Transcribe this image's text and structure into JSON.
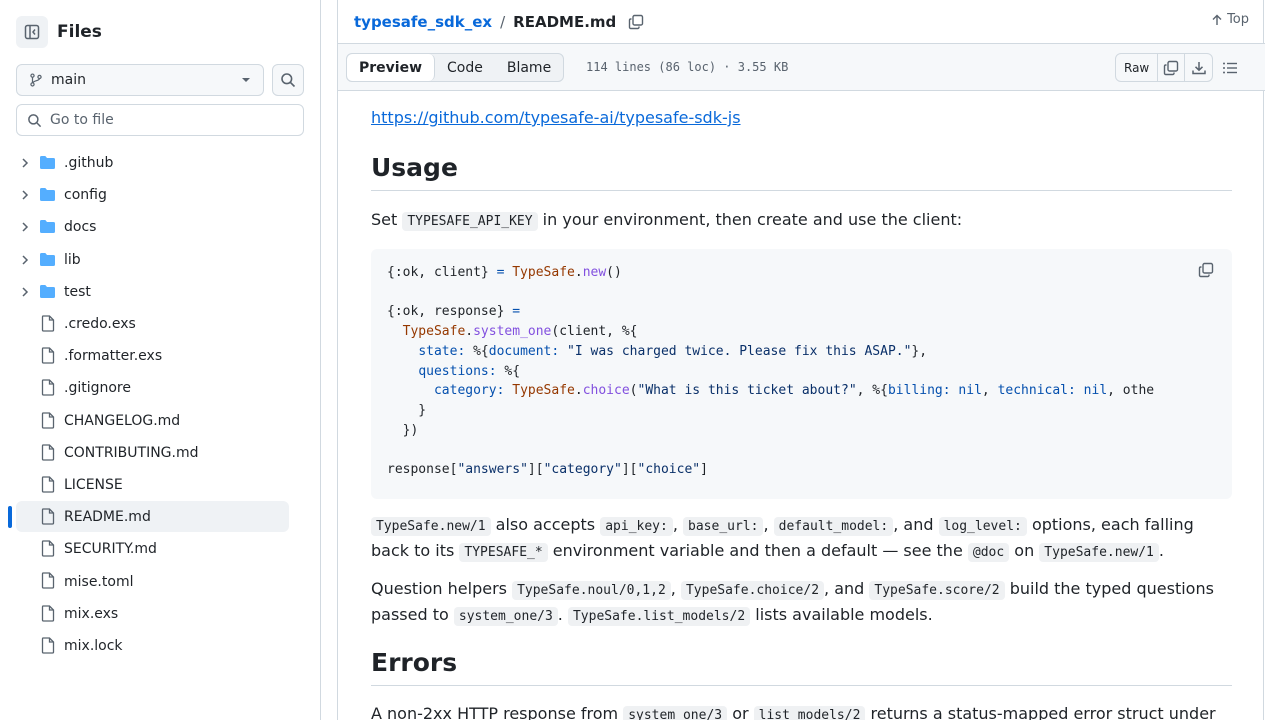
{
  "sidebar": {
    "title": "Files",
    "branch": "main",
    "goto_placeholder": "Go to file",
    "items": [
      {
        "name": ".github",
        "type": "folder"
      },
      {
        "name": "config",
        "type": "folder"
      },
      {
        "name": "docs",
        "type": "folder"
      },
      {
        "name": "lib",
        "type": "folder"
      },
      {
        "name": "test",
        "type": "folder"
      },
      {
        "name": ".credo.exs",
        "type": "file"
      },
      {
        "name": ".formatter.exs",
        "type": "file"
      },
      {
        "name": ".gitignore",
        "type": "file"
      },
      {
        "name": "CHANGELOG.md",
        "type": "file"
      },
      {
        "name": "CONTRIBUTING.md",
        "type": "file"
      },
      {
        "name": "LICENSE",
        "type": "file"
      },
      {
        "name": "README.md",
        "type": "file",
        "selected": true
      },
      {
        "name": "SECURITY.md",
        "type": "file"
      },
      {
        "name": "mise.toml",
        "type": "file"
      },
      {
        "name": "mix.exs",
        "type": "file"
      },
      {
        "name": "mix.lock",
        "type": "file"
      }
    ]
  },
  "header": {
    "repo": "typesafe_sdk_ex",
    "separator": "/",
    "file": "README.md",
    "top_label": "Top"
  },
  "filebar": {
    "tabs": [
      "Preview",
      "Code",
      "Blame"
    ],
    "active_tab": "Preview",
    "info": "114 lines (86 loc) · 3.55 KB",
    "raw_label": "Raw"
  },
  "readme": {
    "link": "https://github.com/typesafe-ai/typesafe-sdk-js",
    "usage_heading": "Usage",
    "usage_intro": {
      "before": "Set ",
      "code": "TYPESAFE_API_KEY",
      "after": " in your environment, then create and use the client:"
    },
    "code_lines": [
      "{:ok, client} = TypeSafe.new()",
      "",
      "{:ok, response} =",
      "  TypeSafe.system_one(client, %{",
      "    state: %{document: \"I was charged twice. Please fix this ASAP.\"},",
      "    questions: %{",
      "      category: TypeSafe.choice(\"What is this ticket about?\", %{billing: nil, technical: nil, othe",
      "    }",
      "  })",
      "",
      "response[\"answers\"][\"category\"][\"choice\"]"
    ],
    "p1": {
      "c1": "TypeSafe.new/1",
      "t1": " also accepts ",
      "c2": "api_key:",
      "t2": ", ",
      "c3": "base_url:",
      "t3": ", ",
      "c4": "default_model:",
      "t4": ", and ",
      "c5": "log_level:",
      "t5": " options, each falling back to its ",
      "c6": "TYPESAFE_*",
      "t6": " environment variable and then a default — see the ",
      "c7": "@doc",
      "t7": " on ",
      "c8": "TypeSafe.new/1",
      "t8": "."
    },
    "p2": {
      "t1": "Question helpers ",
      "c1": "TypeSafe.noul/0,1,2",
      "t2": ", ",
      "c2": "TypeSafe.choice/2",
      "t3": ", and ",
      "c3": "TypeSafe.score/2",
      "t4": " build the typed questions passed to ",
      "c4": "system_one/3",
      "t5": ". ",
      "c5": "TypeSafe.list_models/2",
      "t6": " lists available models."
    },
    "errors_heading": "Errors",
    "p3": {
      "t1": "A non-2xx HTTP response from ",
      "c1": "system_one/3",
      "t2": " or ",
      "c2": "list_models/2",
      "t3": " returns a status-mapped error struct under"
    }
  }
}
